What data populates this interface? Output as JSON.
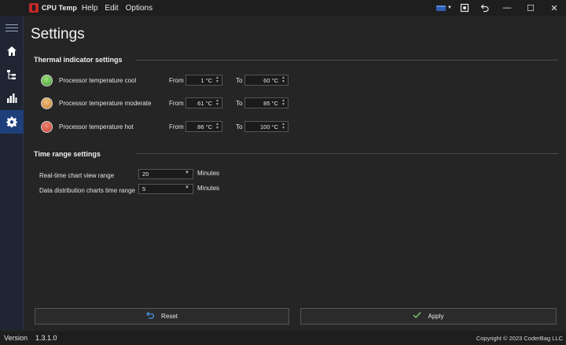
{
  "app": {
    "name": "CPU Temp"
  },
  "menu": [
    "Help",
    "Edit",
    "Options"
  ],
  "colors": {
    "accent": "#1f3f7a",
    "apply_check": "#7ec86a",
    "reset_icon": "#4a90e2"
  },
  "page": {
    "title": "Settings"
  },
  "thermal": {
    "title": "Thermal indicator settings",
    "from_label": "From",
    "to_label": "To",
    "rows": [
      {
        "label": "Processor temperature cool",
        "from": "1 °C",
        "to": "60 °C",
        "status": "green"
      },
      {
        "label": "Processor temperature moderate",
        "from": "61 °C",
        "to": "85 °C",
        "status": "orange"
      },
      {
        "label": "Processor temperature hot",
        "from": "86 °C",
        "to": "100 °C",
        "status": "red"
      }
    ]
  },
  "time_range": {
    "title": "Time range settings",
    "rows": [
      {
        "label": "Real-time chart view range",
        "value": "20",
        "unit": "Minutes"
      },
      {
        "label": "Data distribution charts time range",
        "value": "5",
        "unit": "Minutes"
      }
    ]
  },
  "buttons": {
    "reset": "Reset",
    "apply": "Apply"
  },
  "status": {
    "version_label": "Version",
    "version": "1.3.1.0",
    "copyright": "Copyright © 2023 CoderBag LLC"
  }
}
